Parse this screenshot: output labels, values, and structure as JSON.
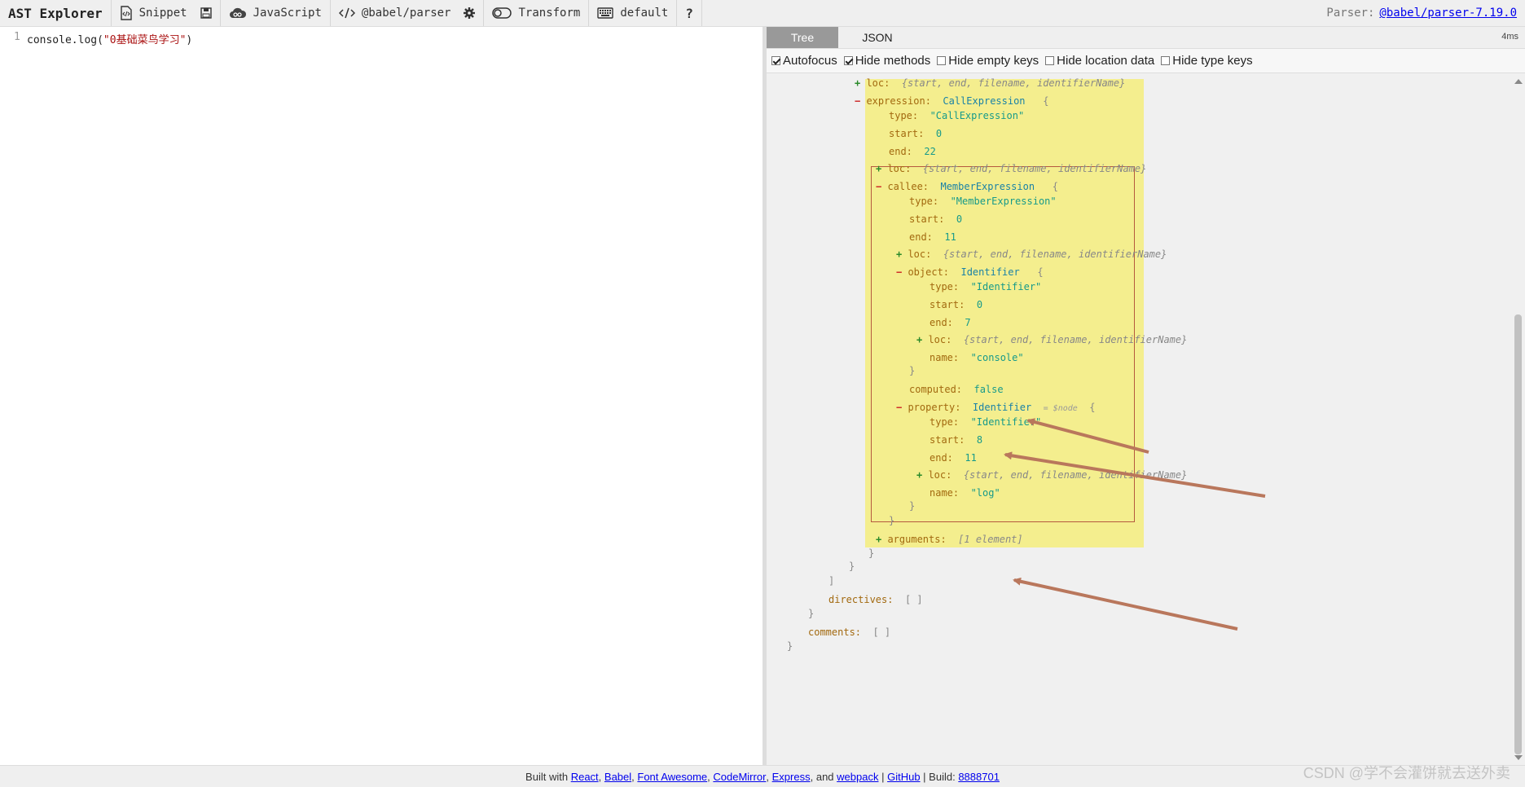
{
  "toolbar": {
    "title": "AST Explorer",
    "snippet": "Snippet",
    "language": "JavaScript",
    "parser": "@babel/parser",
    "transform": "Transform",
    "keymap": "default",
    "help": "?",
    "parser_label": "Parser:",
    "parser_link": "@babel/parser-7.19.0"
  },
  "editor": {
    "line_number": "1",
    "code_prefix": "console.log(",
    "code_string": "\"0基础菜鸟学习\"",
    "code_suffix": ")"
  },
  "output": {
    "tabs": [
      "Tree",
      "JSON"
    ],
    "timing": "4ms",
    "options": [
      {
        "label": "Autofocus",
        "checked": true
      },
      {
        "label": "Hide methods",
        "checked": true
      },
      {
        "label": "Hide empty keys",
        "checked": false
      },
      {
        "label": "Hide location data",
        "checked": false
      },
      {
        "label": "Hide type keys",
        "checked": false
      }
    ]
  },
  "tree": {
    "loc_summary": "{start, end, filename, identifierName}",
    "expression": {
      "key": "expression:",
      "type": "CallExpression"
    },
    "type_key": "type:",
    "start_key": "start:",
    "end_key": "end:",
    "loc_key": "loc:",
    "name_key": "name:",
    "call": {
      "type_val": "\"CallExpression\"",
      "start": "0",
      "end": "22"
    },
    "callee": {
      "key": "callee:",
      "type": "MemberExpression",
      "type_val": "\"MemberExpression\"",
      "start": "0",
      "end": "11"
    },
    "object": {
      "key": "object:",
      "type": "Identifier",
      "type_val": "\"Identifier\"",
      "start": "0",
      "end": "7",
      "name": "\"console\""
    },
    "computed": {
      "key": "computed:",
      "value": "false"
    },
    "property": {
      "key": "property:",
      "type": "Identifier",
      "node_ref": "$node",
      "type_val": "\"Identifier\"",
      "start": "8",
      "end": "11",
      "name": "\"log\""
    },
    "arguments": {
      "key": "arguments:",
      "summary": "[1 element]"
    },
    "directives": {
      "key": "directives:",
      "value": "[ ]"
    },
    "comments": {
      "key": "comments:",
      "value": "[ ]"
    }
  },
  "footer": {
    "built_with": "Built with",
    "links": [
      "React",
      "Babel",
      "Font Awesome",
      "CodeMirror",
      "Express",
      "webpack",
      "GitHub"
    ],
    "and": "and",
    "build_label": "Build:",
    "build": "8888701"
  },
  "watermark": "CSDN @学不会灌饼就去送外卖",
  "colors": {
    "highlight": "#f4ee8e",
    "box": "#b5593f",
    "arrow": "#b9775c"
  }
}
